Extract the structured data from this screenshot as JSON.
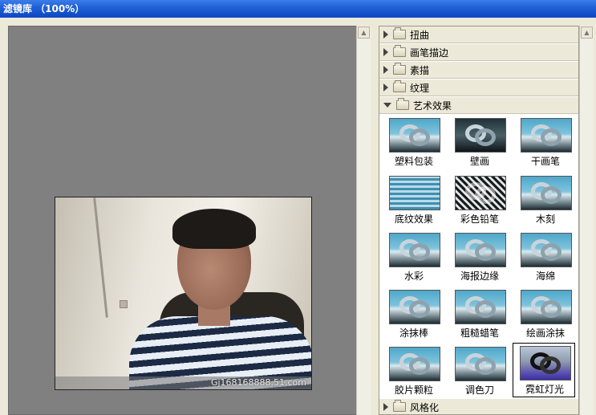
{
  "window": {
    "title": "滤镜库 （100%）"
  },
  "preview": {
    "watermark": "Gj168168888.51.com"
  },
  "categories": {
    "distort": "扭曲",
    "brush_strokes": "画笔描边",
    "sketch": "素描",
    "texture": "纹理",
    "artistic": "艺术效果",
    "stylize": "风格化"
  },
  "artistic_filters": [
    {
      "label": "塑料包装",
      "style": "normal"
    },
    {
      "label": "壁画",
      "style": "dark"
    },
    {
      "label": "干画笔",
      "style": "normal"
    },
    {
      "label": "底纹效果",
      "style": "stripes"
    },
    {
      "label": "彩色铅笔",
      "style": "color-pencil"
    },
    {
      "label": "木刻",
      "style": "normal"
    },
    {
      "label": "水彩",
      "style": "normal"
    },
    {
      "label": "海报边缘",
      "style": "normal"
    },
    {
      "label": "海绵",
      "style": "normal"
    },
    {
      "label": "涂抹棒",
      "style": "normal"
    },
    {
      "label": "粗糙蜡笔",
      "style": "normal"
    },
    {
      "label": "绘画涂抹",
      "style": "normal"
    },
    {
      "label": "胶片颗粒",
      "style": "normal"
    },
    {
      "label": "调色刀",
      "style": "normal"
    },
    {
      "label": "霓虹灯光",
      "style": "neon",
      "selected": true
    }
  ]
}
